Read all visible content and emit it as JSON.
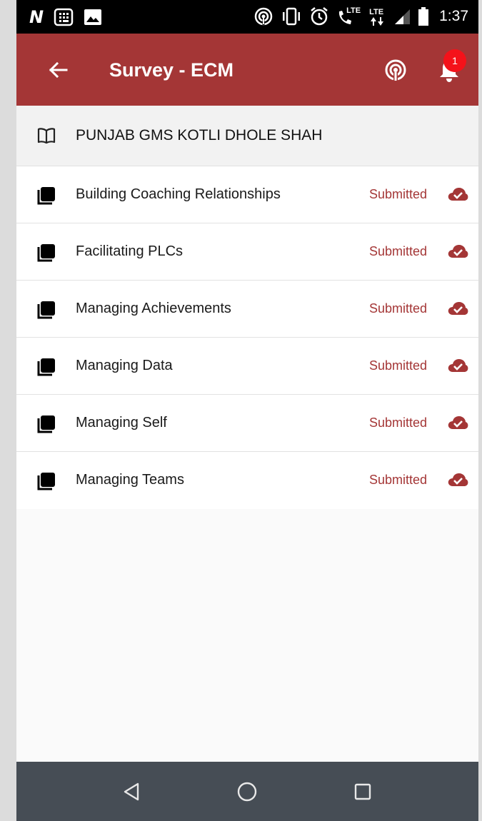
{
  "status_bar": {
    "time": "1:37",
    "lte_a": "LTE",
    "lte_b": "LTE",
    "icons": [
      "n-logo-icon",
      "calculator-icon",
      "image-icon",
      "hotspot-icon",
      "vibrate-icon",
      "alarm-icon",
      "wifi-calling-icon",
      "lte-signal-icon",
      "signal-strength-icon",
      "battery-icon"
    ]
  },
  "app_bar": {
    "title": "Survey - ECM",
    "notification_count": "1",
    "color": "#a43636"
  },
  "school": {
    "name": "PUNJAB GMS KOTLI DHOLE SHAH"
  },
  "surveys": [
    {
      "label": "Building Coaching Relationships",
      "status": "Submitted"
    },
    {
      "label": "Facilitating PLCs",
      "status": "Submitted"
    },
    {
      "label": "Managing Achievements",
      "status": "Submitted"
    },
    {
      "label": "Managing Data",
      "status": "Submitted"
    },
    {
      "label": "Managing Self",
      "status": "Submitted"
    },
    {
      "label": "Managing Teams",
      "status": "Submitted"
    }
  ],
  "nav_bar": {
    "buttons": [
      "back-triangle-icon",
      "home-circle-icon",
      "recents-square-icon"
    ],
    "color": "#464d55"
  }
}
